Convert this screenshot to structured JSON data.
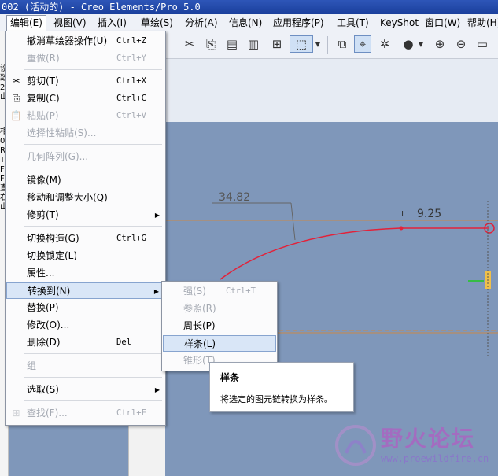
{
  "titlebar": {
    "text": "002 (活动的) - Creo Elements/Pro 5.0"
  },
  "menubar": {
    "items": [
      "编辑(E)",
      "视图(V)",
      "插入(I)",
      "草绘(S)",
      "分析(A)",
      "信息(N)",
      "应用程序(P)",
      "工具(T)",
      "KeyShot",
      "窗口(W)",
      "帮助(H)"
    ]
  },
  "toolbar": {
    "icons": [
      "cut-icon",
      "copy-icon",
      "paste-icon",
      "paste-special-icon",
      "binoculars-icon",
      "select-box-icon",
      "sketch-view-icon",
      "sketch-mode-icon",
      "regenerate-icon",
      "shade-sphere-icon",
      "zoom-in-icon",
      "zoom-out-icon",
      "refit-icon"
    ]
  },
  "sketch": {
    "dim_arc": "34.82",
    "dim_right": "9.25",
    "dim_right_prefix": "L"
  },
  "edit_menu": {
    "items": [
      {
        "label": "撤消草绘器操作(U)",
        "shortcut": "Ctrl+Z",
        "icon": "",
        "disabled": false
      },
      {
        "label": "重做(R)",
        "shortcut": "Ctrl+Y",
        "icon": "",
        "disabled": true
      },
      {
        "label": "剪切(T)",
        "shortcut": "Ctrl+X",
        "icon": "✂",
        "disabled": false
      },
      {
        "label": "复制(C)",
        "shortcut": "Ctrl+C",
        "icon": "⎘",
        "disabled": false
      },
      {
        "label": "粘贴(P)",
        "shortcut": "Ctrl+V",
        "icon": "📋",
        "disabled": true
      },
      {
        "label": "选择性粘贴(S)...",
        "shortcut": "",
        "icon": "",
        "disabled": true
      },
      {
        "label": "几何阵列(G)...",
        "shortcut": "",
        "icon": "",
        "disabled": true
      },
      {
        "label": "镜像(M)",
        "shortcut": "",
        "icon": "",
        "disabled": false
      },
      {
        "label": "移动和调整大小(Q)",
        "shortcut": "",
        "icon": "",
        "disabled": false
      },
      {
        "label": "修剪(T)",
        "shortcut": "",
        "icon": "",
        "disabled": false,
        "submenu": true
      },
      {
        "label": "切换构造(G)",
        "shortcut": "Ctrl+G",
        "icon": "",
        "disabled": false
      },
      {
        "label": "切换锁定(L)",
        "shortcut": "",
        "icon": "",
        "disabled": false
      },
      {
        "label": "属性...",
        "shortcut": "",
        "icon": "",
        "disabled": false
      },
      {
        "label": "转换到(N)",
        "shortcut": "",
        "icon": "",
        "disabled": false,
        "submenu": true,
        "highlighted": true
      },
      {
        "label": "替换(P)",
        "shortcut": "",
        "icon": "",
        "disabled": false
      },
      {
        "label": "修改(O)...",
        "shortcut": "",
        "icon": "",
        "disabled": false
      },
      {
        "label": "删除(D)",
        "shortcut": "Del",
        "icon": "",
        "disabled": false
      },
      {
        "label": "组",
        "shortcut": "",
        "icon": "",
        "disabled": true
      },
      {
        "label": "选取(S)",
        "shortcut": "",
        "icon": "",
        "disabled": false,
        "submenu": true
      },
      {
        "label": "查找(F)...",
        "shortcut": "Ctrl+F",
        "icon": "",
        "disabled": true
      }
    ]
  },
  "convert_submenu": {
    "items": [
      {
        "label": "强(S)",
        "shortcut": "Ctrl+T",
        "disabled": true
      },
      {
        "label": "参照(R)",
        "shortcut": "",
        "disabled": true
      },
      {
        "label": "周长(P)",
        "shortcut": "",
        "disabled": false
      },
      {
        "label": "样条(L)",
        "shortcut": "",
        "disabled": false,
        "highlighted": true
      },
      {
        "label": "锥形(T)",
        "shortcut": "",
        "disabled": true
      }
    ]
  },
  "tooltip": {
    "title": "样条",
    "text": "将选定的图元链转换为样条。"
  },
  "watermark": {
    "title": "野火论坛",
    "url": "www.proewildfire.cn"
  },
  "left_panel": {
    "fragments": [
      "设",
      "致",
      "2",
      "山",
      "相",
      "0(",
      "R",
      "T",
      "F",
      "F",
      "直",
      "右",
      "山"
    ]
  }
}
